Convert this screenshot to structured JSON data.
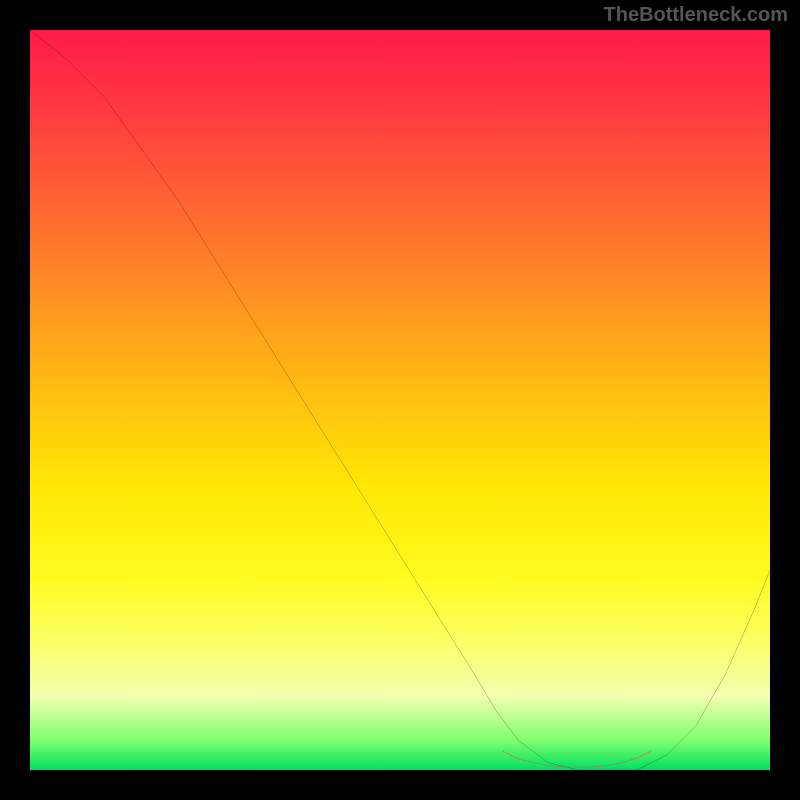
{
  "watermark": "TheBottleneck.com",
  "chart_data": {
    "type": "line",
    "title": "",
    "xlabel": "",
    "ylabel": "",
    "xlim": [
      0,
      100
    ],
    "ylim": [
      0,
      100
    ],
    "grid": false,
    "legend": false,
    "background": {
      "type": "vertical-gradient",
      "stops": [
        {
          "pos": 0,
          "color": "#ff1a4a"
        },
        {
          "pos": 25,
          "color": "#ff6a30"
        },
        {
          "pos": 50,
          "color": "#ffc210"
        },
        {
          "pos": 75,
          "color": "#fffb20"
        },
        {
          "pos": 100,
          "color": "#00e060"
        }
      ]
    },
    "series": [
      {
        "name": "bottleneck-curve",
        "color": "#000000",
        "x": [
          0,
          5,
          10,
          15,
          20,
          25,
          30,
          35,
          40,
          45,
          50,
          55,
          60,
          63,
          66,
          70,
          74,
          78,
          82,
          86,
          90,
          94,
          98,
          100
        ],
        "y": [
          100,
          96,
          91,
          84,
          77,
          69,
          61,
          53,
          45,
          37,
          29,
          21,
          13,
          8,
          4,
          1,
          0,
          0,
          0,
          2,
          6,
          13,
          22,
          27
        ]
      },
      {
        "name": "optimal-range-marker",
        "color": "#d9534f",
        "style": "dotted-thick",
        "x": [
          64,
          66,
          68,
          70,
          72,
          74,
          76,
          78,
          80,
          82,
          84
        ],
        "y": [
          2.5,
          1.5,
          1.0,
          0.6,
          0.4,
          0.4,
          0.4,
          0.6,
          1.0,
          1.6,
          2.6
        ]
      }
    ]
  }
}
